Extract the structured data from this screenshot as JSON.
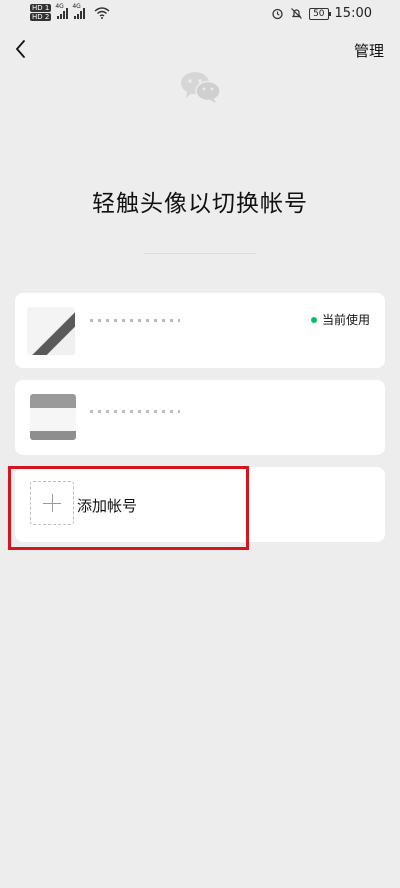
{
  "status_bar": {
    "time": "15:00",
    "battery_level": "50",
    "sim_badges": [
      "HD 1",
      "HD 2"
    ],
    "network_labels": [
      "4G",
      "4G"
    ],
    "icons": [
      "alarm-icon",
      "mute-bell-icon",
      "battery-icon",
      "wifi-icon",
      "signal-icon"
    ]
  },
  "nav": {
    "back_icon": "chevron-left-icon",
    "manage_label": "管理"
  },
  "logo": {
    "icon": "wechat-logo-icon",
    "color": "#d6d6d6"
  },
  "title": "轻触头像以切换帐号",
  "accounts": [
    {
      "status_text": "当前使用",
      "status_color": "#07c160"
    },
    {
      "status_text": ""
    }
  ],
  "add_account": {
    "label": "添加帐号",
    "icon": "plus-icon"
  },
  "highlight": {
    "color": "#d5141d"
  }
}
